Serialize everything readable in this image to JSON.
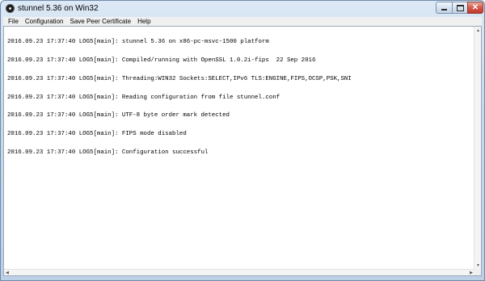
{
  "window": {
    "title": "stunnel 5.36 on Win32"
  },
  "titlebar": {
    "minimize_icon": "minimize-icon",
    "maximize_icon": "maximize-icon",
    "close_icon": "close-icon",
    "close_glyph": "✕"
  },
  "menu": {
    "items": [
      {
        "label": "File"
      },
      {
        "label": "Configuration"
      },
      {
        "label": "Save Peer Certificate"
      },
      {
        "label": "Help"
      }
    ]
  },
  "log": {
    "lines": [
      "2016.09.23 17:37:40 LOG5[main]: stunnel 5.36 on x86-pc-msvc-1500 platform",
      "2016.09.23 17:37:40 LOG5[main]: Compiled/running with OpenSSL 1.0.2i-fips  22 Sep 2016",
      "2016.09.23 17:37:40 LOG5[main]: Threading:WIN32 Sockets:SELECT,IPv6 TLS:ENGINE,FIPS,OCSP,PSK,SNI",
      "2016.09.23 17:37:40 LOG5[main]: Reading configuration from file stunnel.conf",
      "2016.09.23 17:37:40 LOG5[main]: UTF-8 byte order mark detected",
      "2016.09.23 17:37:40 LOG5[main]: FIPS mode disabled",
      "2016.09.23 17:37:40 LOG5[main]: Configuration successful"
    ]
  },
  "scrollbars": {
    "up_arrow": "▲",
    "down_arrow": "▼",
    "left_arrow": "◀",
    "right_arrow": "▶"
  },
  "colors": {
    "titlebar": "#c9dbee",
    "close_button": "#c0392b",
    "log_background": "#ffffff"
  }
}
